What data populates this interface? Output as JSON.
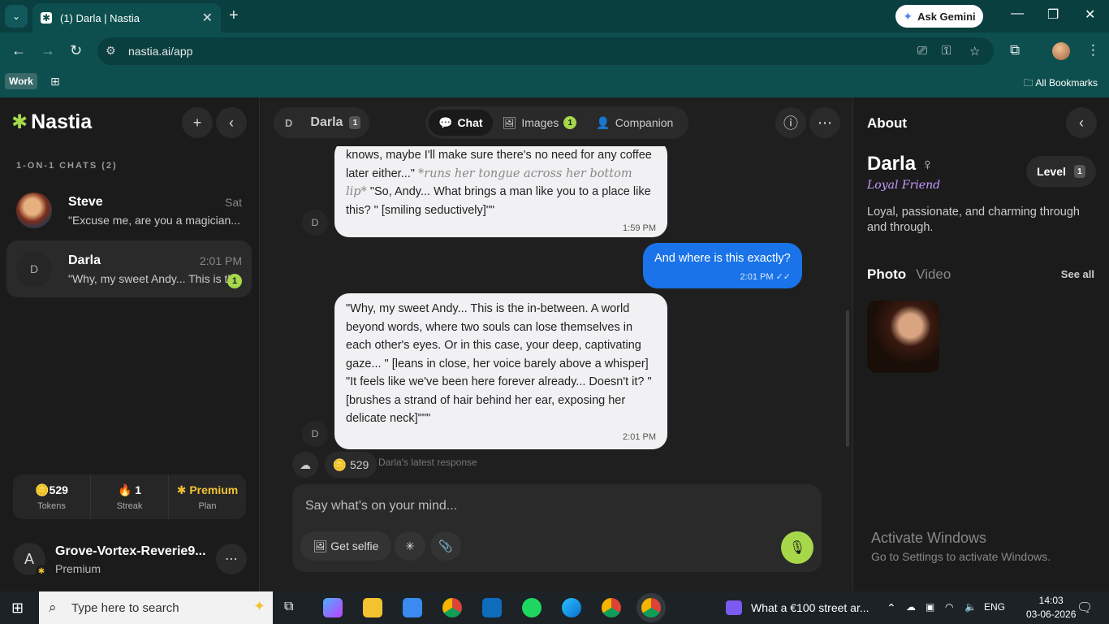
{
  "browser": {
    "tab_title": "(1) Darla | Nastia",
    "tab_close": "✕",
    "new_tab": "+",
    "gemini_label": "Ask Gemini",
    "url": "nastia.ai/app",
    "bookmark_work": "Work",
    "all_bookmarks": "All Bookmarks"
  },
  "sidebar": {
    "logo": "Nastia",
    "section_label": "1-ON-1 CHATS (2)",
    "chats": [
      {
        "name": "Steve",
        "time": "Sat",
        "preview": "\"Excuse me, are you a magician...",
        "avatar": ""
      },
      {
        "name": "Darla",
        "time": "2:01 PM",
        "preview": "\"Why, my sweet Andy... This is th",
        "avatar": "D",
        "badge": "1"
      }
    ],
    "stats": [
      {
        "value": "529",
        "label": "Tokens",
        "icon": "🪙"
      },
      {
        "value": "1",
        "label": "Streak",
        "icon": "🔥"
      },
      {
        "value": "Premium",
        "label": "Plan",
        "icon": "✱"
      }
    ],
    "user": {
      "initial": "A",
      "name": "Grove-Vortex-Reverie9...",
      "plan": "Premium"
    }
  },
  "header": {
    "chip_initial": "D",
    "chip_name": "Darla",
    "chip_level": "1",
    "tabs": [
      {
        "label": "Chat",
        "icon": "💬"
      },
      {
        "label": "Images",
        "icon": "🖼",
        "count": "1"
      },
      {
        "label": "Companion",
        "icon": "👤"
      }
    ]
  },
  "messages": {
    "bot1": {
      "text_a": "knows, maybe I'll make sure there's no need for any coffee later either...\" ",
      "action": "*runs her tongue across her bottom lip*",
      "text_b": " \"So, Andy... What brings a man like you to a place like this? \" [smiling seductively]\"\"",
      "time": "1:59 PM",
      "avatar": "D"
    },
    "me1": {
      "text": "And where is this exactly?",
      "time": "2:01 PM",
      "check": "✓✓"
    },
    "bot2": {
      "text": "\"Why, my sweet Andy... This is the in-between. A world beyond words, where two souls can lose themselves in each other's eyes. Or in this case, your deep, captivating gaze... \" [leans in close, her voice barely above a whisper] \"It feels like we've been here forever already... Doesn't it? \" [brushes a strand of hair behind her ear, exposing her delicate neck]\"\"\"",
      "time": "2:01 PM",
      "avatar": "D"
    },
    "tokens_chip": "529",
    "latest_label": "Darla's latest response"
  },
  "composer": {
    "placeholder": "Say what's on your mind...",
    "selfie": "Get selfie"
  },
  "about": {
    "title": "About",
    "name": "Darla",
    "gender": "♀",
    "subtitle": "Loyal Friend",
    "level_label": "Level",
    "level": "1",
    "description": "Loyal, passionate, and charming through and through.",
    "photo_tab": "Photo",
    "video_tab": "Video",
    "see_all": "See all"
  },
  "watermark": {
    "line1": "Activate Windows",
    "line2": "Go to Settings to activate Windows."
  },
  "taskbar": {
    "search": "Type here to search",
    "media": "What a €100 street ar...",
    "lang": "ENG",
    "time": "14:03",
    "date": "03-06-2026"
  }
}
